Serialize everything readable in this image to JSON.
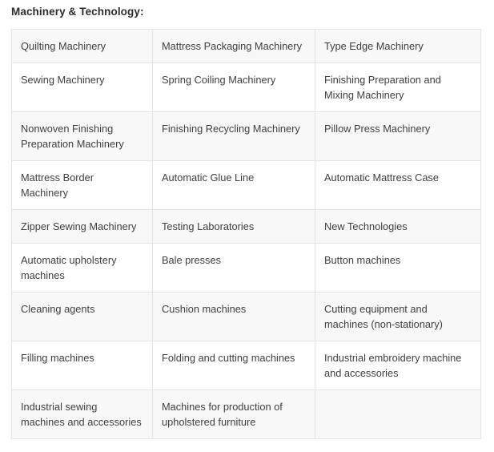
{
  "heading": "Machinery & Technology:",
  "table": {
    "columns": 3,
    "rows": [
      [
        "Quilting Machinery",
        "Mattress Packaging Machinery",
        "Type Edge Machinery"
      ],
      [
        "Sewing Machinery",
        "Spring Coiling Machinery",
        "Finishing Preparation and Mixing Machinery"
      ],
      [
        "Nonwoven Finishing Preparation Machinery",
        "Finishing Recycling Machinery",
        "Pillow Press Machinery"
      ],
      [
        "Mattress Border Machinery",
        "Automatic Glue Line",
        "Automatic Mattress Case"
      ],
      [
        "Zipper Sewing Machinery",
        "Testing Laboratories",
        "New Technologies"
      ],
      [
        "Automatic upholstery machines",
        "Bale presses",
        "Button machines"
      ],
      [
        "Cleaning agents",
        "Cushion machines",
        "Cutting equipment and machines (non-stationary)"
      ],
      [
        "Filling machines",
        "Folding and cutting machines",
        "Industrial embroidery machine and accessories"
      ],
      [
        "Industrial sewing machines and accessories",
        "Machines for production of upholstered furniture",
        ""
      ]
    ]
  },
  "colors": {
    "page_background": "#ffffff",
    "row_shaded": "#f8f8f8",
    "row_plain": "#ffffff",
    "border": "#e4e4e4",
    "heading_text": "#2d2d2d",
    "cell_text": "#3f3f3f"
  }
}
